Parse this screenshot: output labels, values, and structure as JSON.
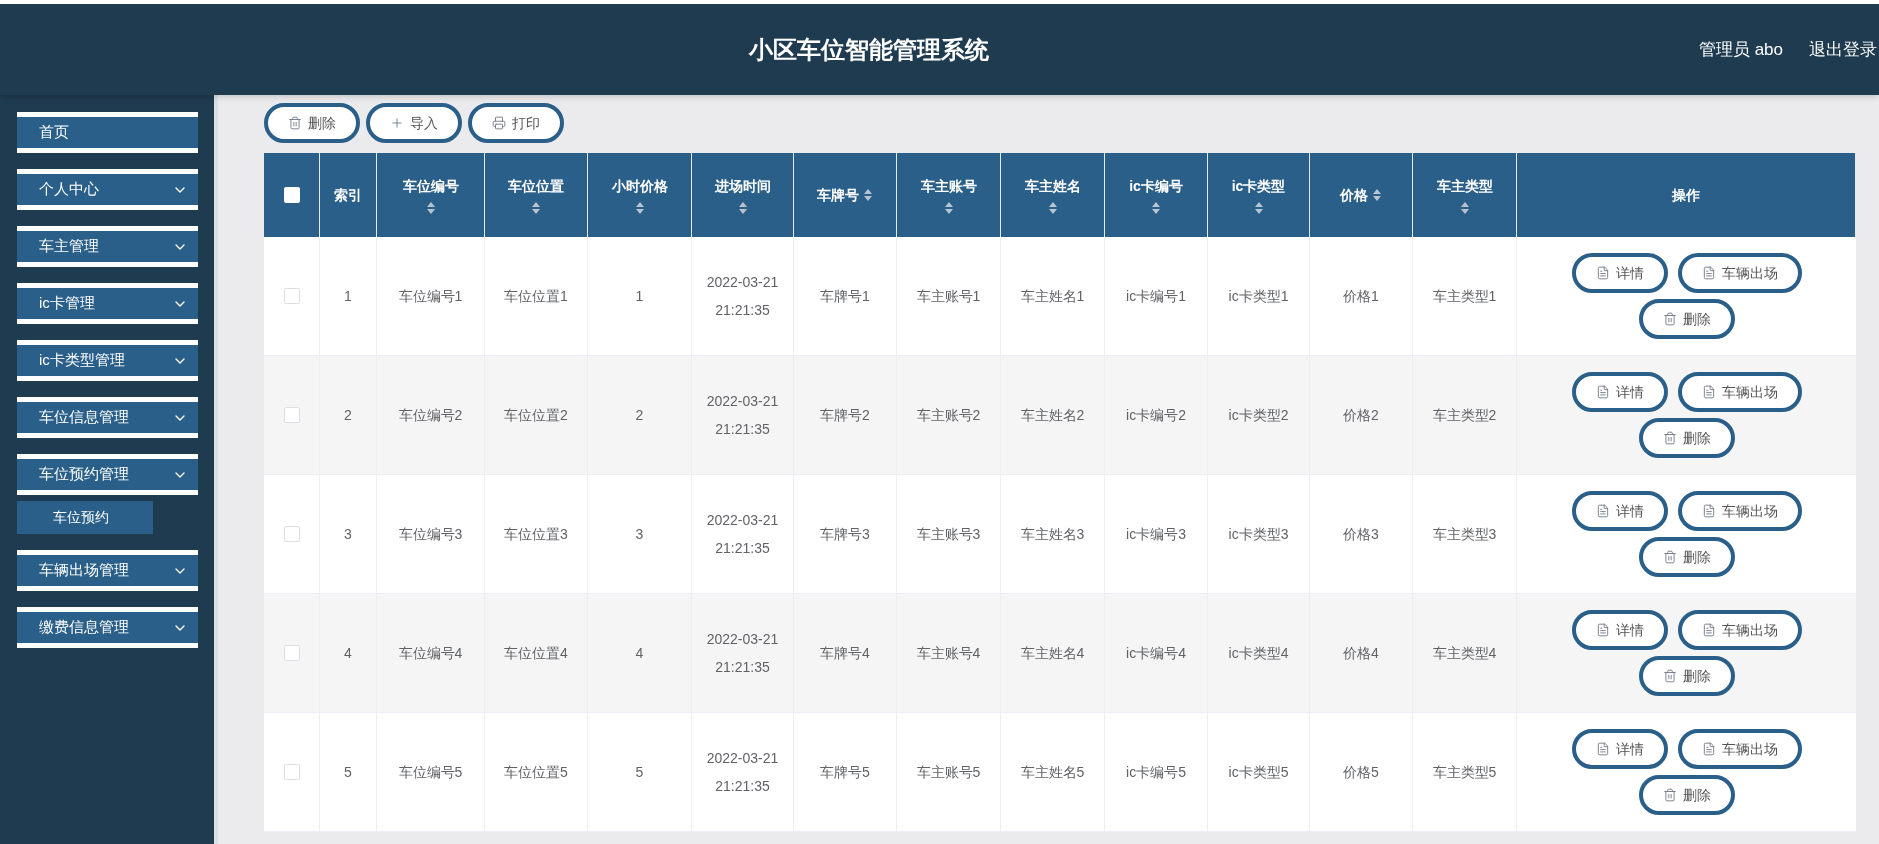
{
  "header": {
    "title": "小区车位智能管理系统",
    "user": "管理员 abo",
    "logout": "退出登录"
  },
  "sidebar": {
    "items": [
      {
        "label": "首页",
        "kind": "link"
      },
      {
        "label": "个人中心",
        "kind": "group"
      },
      {
        "label": "车主管理",
        "kind": "group"
      },
      {
        "label": "ic卡管理",
        "kind": "group"
      },
      {
        "label": "ic卡类型管理",
        "kind": "group"
      },
      {
        "label": "车位信息管理",
        "kind": "group"
      },
      {
        "label": "车位预约管理",
        "kind": "group",
        "children": [
          {
            "label": "车位预约",
            "selected": true
          }
        ]
      },
      {
        "label": "车辆出场管理",
        "kind": "group"
      },
      {
        "label": "缴费信息管理",
        "kind": "group"
      }
    ]
  },
  "toolbar": [
    {
      "label": "删除",
      "kind": "delete"
    },
    {
      "label": "导入",
      "kind": "import"
    },
    {
      "label": "打印",
      "kind": "print"
    }
  ],
  "table": {
    "header_checkbox": {
      "checked": false
    },
    "columns": [
      {
        "label": "索引",
        "kind": "plain"
      },
      {
        "label": "车位编号",
        "kind": "sort_below"
      },
      {
        "label": "车位位置",
        "kind": "sort_below"
      },
      {
        "label": "小时价格",
        "kind": "sort_below"
      },
      {
        "label": "进场时间",
        "kind": "sort_below"
      },
      {
        "label": "车牌号",
        "kind": "sort_inline"
      },
      {
        "label": "车主账号",
        "kind": "sort_below"
      },
      {
        "label": "车主姓名",
        "kind": "sort_below"
      },
      {
        "label": "ic卡编号",
        "kind": "sort_below"
      },
      {
        "label": "ic卡类型",
        "kind": "sort_below"
      },
      {
        "label": "价格",
        "kind": "sort_inline"
      },
      {
        "label": "车主类型",
        "kind": "sort_below"
      },
      {
        "label": "操作",
        "kind": "plain"
      }
    ],
    "rows": [
      {
        "checked": false,
        "cells": [
          "1",
          "车位编号1",
          "车位位置1",
          "1",
          "2022-03-21 21:21:35",
          "车牌号1",
          "车主账号1",
          "车主姓名1",
          "ic卡编号1",
          "ic卡类型1",
          "价格1",
          "车主类型1"
        ],
        "actions": [
          {
            "label": "详情",
            "kind": "doc"
          },
          {
            "label": "车辆出场",
            "kind": "doc"
          },
          {
            "label": "删除",
            "kind": "delete"
          }
        ]
      },
      {
        "checked": false,
        "cells": [
          "2",
          "车位编号2",
          "车位位置2",
          "2",
          "2022-03-21 21:21:35",
          "车牌号2",
          "车主账号2",
          "车主姓名2",
          "ic卡编号2",
          "ic卡类型2",
          "价格2",
          "车主类型2"
        ],
        "actions": [
          {
            "label": "详情",
            "kind": "doc"
          },
          {
            "label": "车辆出场",
            "kind": "doc"
          },
          {
            "label": "删除",
            "kind": "delete"
          }
        ]
      },
      {
        "checked": false,
        "cells": [
          "3",
          "车位编号3",
          "车位位置3",
          "3",
          "2022-03-21 21:21:35",
          "车牌号3",
          "车主账号3",
          "车主姓名3",
          "ic卡编号3",
          "ic卡类型3",
          "价格3",
          "车主类型3"
        ],
        "actions": [
          {
            "label": "详情",
            "kind": "doc"
          },
          {
            "label": "车辆出场",
            "kind": "doc"
          },
          {
            "label": "删除",
            "kind": "delete"
          }
        ]
      },
      {
        "checked": false,
        "cells": [
          "4",
          "车位编号4",
          "车位位置4",
          "4",
          "2022-03-21 21:21:35",
          "车牌号4",
          "车主账号4",
          "车主姓名4",
          "ic卡编号4",
          "ic卡类型4",
          "价格4",
          "车主类型4"
        ],
        "actions": [
          {
            "label": "详情",
            "kind": "doc"
          },
          {
            "label": "车辆出场",
            "kind": "doc"
          },
          {
            "label": "删除",
            "kind": "delete"
          }
        ]
      },
      {
        "checked": false,
        "cells": [
          "5",
          "车位编号5",
          "车位位置5",
          "5",
          "2022-03-21 21:21:35",
          "车牌号5",
          "车主账号5",
          "车主姓名5",
          "ic卡编号5",
          "ic卡类型5",
          "价格5",
          "车主类型5"
        ],
        "actions": [
          {
            "label": "详情",
            "kind": "doc"
          },
          {
            "label": "车辆出场",
            "kind": "doc"
          },
          {
            "label": "删除",
            "kind": "delete"
          }
        ]
      }
    ]
  }
}
